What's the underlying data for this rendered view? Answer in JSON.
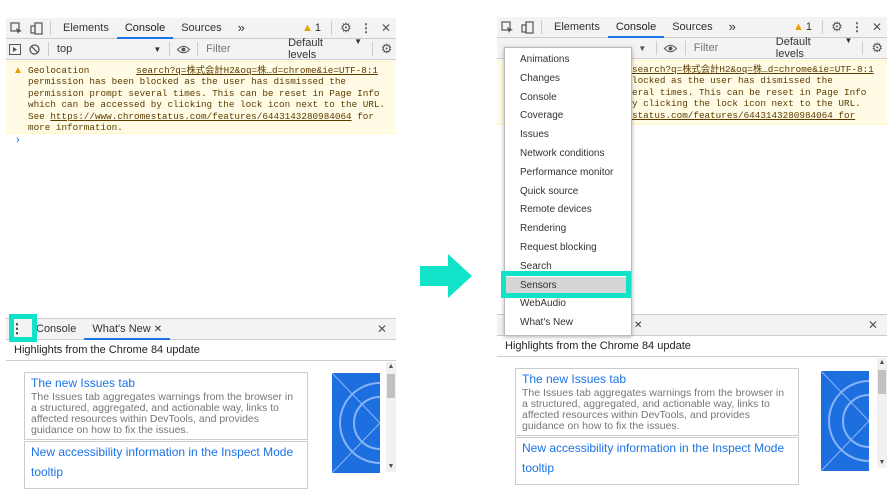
{
  "devtools": {
    "tabs": [
      "Elements",
      "Console",
      "Sources"
    ],
    "more_tabs": "»",
    "warning_count": "1",
    "context_select": "top",
    "filter_placeholder": "Filter",
    "levels_label": "Default levels"
  },
  "warning": {
    "source_link": "search?q=株式会計H2&oq=株…d=chrome&ie=UTF-8:1",
    "line1": "Geolocation",
    "line2": "permission has been blocked as the user has dismissed the",
    "line3": "permission prompt several times. This can be reset in Page Info",
    "line4": "which can be accessed by clicking the lock icon next to the URL.",
    "line5_prefix": "See ",
    "line5_link": "https://www.chromestatus.com/features/6443143280984064",
    "line5_suffix": " for",
    "line6": "more information.",
    "r_line2": "locked as the user has dismissed the",
    "r_line3": "eral times. This can be reset in Page Info",
    "r_line4": "y clicking the lock icon next to the URL.",
    "r_line5": "status.com/features/6443143280984064 for",
    "r_source_link": "search?q=株式会計H2&oq=株…d=chrome&ie=UTF-8:1"
  },
  "prompt_symbol": "›",
  "drawer": {
    "tabs": [
      {
        "label": "Console"
      },
      {
        "label": "What's New"
      }
    ],
    "close_x": "✕",
    "highlights": "Highlights from the Chrome 84 update",
    "card1": {
      "title": "The new Issues tab",
      "desc": "The Issues tab aggregates warnings from the browser in a structured, aggregated, and actionable way, links to affected resources within DevTools, and provides guidance on how to fix the issues."
    },
    "card2": {
      "title": "New accessibility information in the Inspect Mode",
      "title_cont": "tooltip"
    }
  },
  "menu": {
    "items": [
      "Animations",
      "Changes",
      "Console",
      "Coverage",
      "Issues",
      "Network conditions",
      "Performance monitor",
      "Quick source",
      "Remote devices",
      "Rendering",
      "Request blocking",
      "Search",
      "Sensors",
      "WebAudio",
      "What's New"
    ],
    "selected": "Sensors"
  },
  "colors": {
    "highlight": "#11e3c9",
    "accent": "#1a73e8",
    "warning_bg": "#fffbe5"
  }
}
